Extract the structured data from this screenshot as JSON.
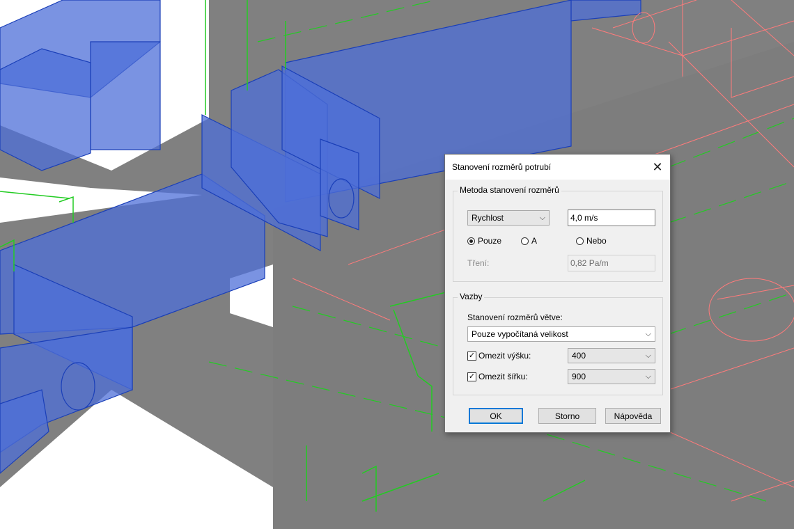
{
  "dialog": {
    "title": "Stanovení rozměrů potrubí",
    "close_icon": "close-icon",
    "method_group": {
      "label": "Metoda stanovení rozměrů",
      "method_select": "Rychlost",
      "velocity_value": "4,0 m/s",
      "radio_options": [
        "Pouze",
        "A",
        "Nebo"
      ],
      "selected_radio": "Pouze",
      "friction_label": "Tření:",
      "friction_value": "0,82 Pa/m"
    },
    "constraints_group": {
      "label": "Vazby",
      "branch_label": "Stanovení rozměrů větve:",
      "branch_select": "Pouze vypočítaná velikost",
      "limit_height_label": "Omezit výšku:",
      "limit_height_checked": true,
      "limit_height_value": "400",
      "limit_width_label": "Omezit šířku:",
      "limit_width_checked": true,
      "limit_width_value": "900"
    },
    "buttons": {
      "ok": "OK",
      "cancel": "Storno",
      "help": "Nápověda"
    }
  }
}
